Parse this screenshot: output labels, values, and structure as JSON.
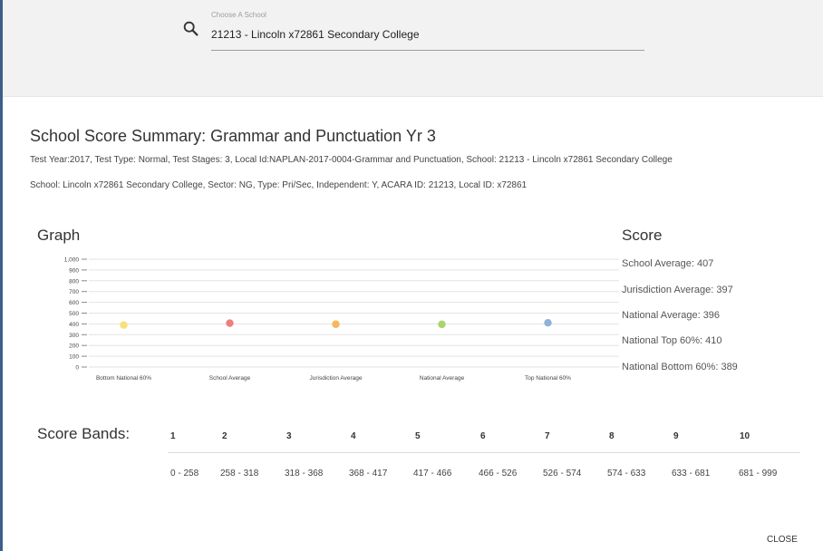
{
  "search": {
    "label": "Choose A School",
    "value": "21213 - Lincoln x72861 Secondary College"
  },
  "summary": {
    "title": "School Score Summary: Grammar and Punctuation Yr 3",
    "info_line1": "Test Year:2017, Test Type: Normal, Test Stages: 3, Local Id:NAPLAN-2017-0004-Grammar and Punctuation, School: 21213 - Lincoln x72861 Secondary College",
    "info_line2": "School: Lincoln x72861 Secondary College, Sector: NG, Type: Pri/Sec, Independent: Y, ACARA ID: 21213, Local ID: x72861"
  },
  "graph": {
    "title": "Graph"
  },
  "score": {
    "title": "Score",
    "items": [
      "School Average: 407",
      "Jurisdiction Average: 397",
      "National Average: 396",
      "National Top 60%: 410",
      "National Bottom 60%: 389"
    ]
  },
  "chart_data": {
    "type": "scatter",
    "categories": [
      "Bottom National 60%",
      "School Average",
      "Jurisdiction Average",
      "National Average",
      "Top National 60%"
    ],
    "values": [
      389,
      407,
      397,
      396,
      410
    ],
    "colors": [
      "#f7e07e",
      "#ee7d7d",
      "#f5b95a",
      "#a9d46f",
      "#8fb2db"
    ],
    "yticks": [
      "0",
      "100",
      "200",
      "300",
      "400",
      "500",
      "600",
      "700",
      "800",
      "900",
      "1,000"
    ],
    "ylim": [
      0,
      1000
    ],
    "grid": true
  },
  "bands": {
    "title": "Score Bands:",
    "numbers": [
      "1",
      "2",
      "3",
      "4",
      "5",
      "6",
      "7",
      "8",
      "9",
      "10"
    ],
    "ranges": [
      "0 - 258",
      "258 - 318",
      "318 - 368",
      "368 - 417",
      "417 - 466",
      "466 - 526",
      "526 - 574",
      "574 - 633",
      "633 - 681",
      "681 - 999"
    ]
  },
  "actions": {
    "close_label": "CLOSE"
  }
}
